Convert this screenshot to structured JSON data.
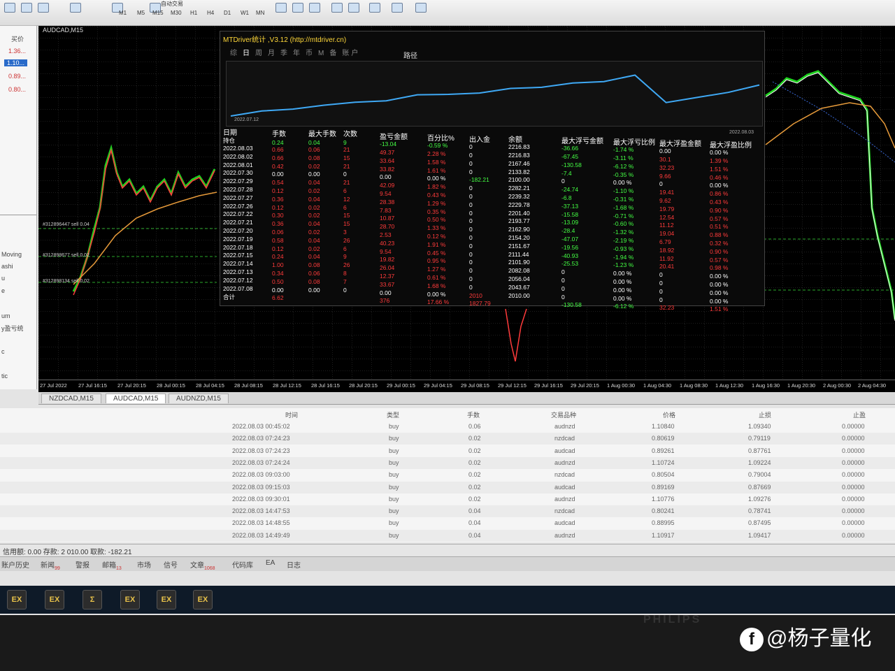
{
  "toolbar": {
    "autotrade_label": "自动交易",
    "timeframes": [
      "M1",
      "M5",
      "M15",
      "M30",
      "H1",
      "H4",
      "D1",
      "W1",
      "MN"
    ]
  },
  "left_panel": {
    "header": "买价",
    "prices": [
      "1.36...",
      "1.10...",
      "0.89...",
      "0.80..."
    ],
    "nav_items": [
      "Moving",
      "ashi",
      "u",
      "e",
      "um",
      "y盈亏统",
      "c",
      "tic"
    ]
  },
  "chart": {
    "title": "AUDCAD,M15",
    "order_labels": [
      "#312896447 sell 0.04",
      "#312898677 sell 0.02",
      "#312898134 sell 0.02"
    ],
    "time_ticks": [
      "27 Jul 2022",
      "27 Jul 16:15",
      "27 Jul 20:15",
      "28 Jul 00:15",
      "28 Jul 04:15",
      "28 Jul 08:15",
      "28 Jul 12:15",
      "28 Jul 16:15",
      "28 Jul 20:15",
      "29 Jul 00:15",
      "29 Jul 04:15",
      "29 Jul 08:15",
      "29 Jul 12:15",
      "29 Jul 16:15",
      "29 Jul 20:15",
      "1 Aug 00:30",
      "1 Aug 04:30",
      "1 Aug 08:30",
      "1 Aug 12:30",
      "1 Aug 16:30",
      "1 Aug 20:30",
      "2 Aug 00:30",
      "2 Aug 04:30"
    ]
  },
  "chart_tabs": [
    "NZDCAD,M15",
    "AUDCAD,M15",
    "AUDNZD,M15"
  ],
  "overlay": {
    "title": "MTDriver统计 ,V3.12 (http://mtdriver.cn)",
    "tabs": [
      "综",
      "日",
      "周",
      "月",
      "季",
      "年",
      "币",
      "M",
      "备",
      "账户"
    ],
    "selected_tab": "日",
    "path_label": "路径",
    "curve_start_date": "2022.07.12",
    "curve_end_date": "2022.08.03",
    "curve_color": "#3fa9f5",
    "headers": [
      "日期",
      "手数",
      "最大手数",
      "次数",
      "盈亏金额",
      "百分比%",
      "出入金",
      "余额",
      "最大浮亏金额",
      "最大浮亏比例",
      "最大浮盈金额",
      "最大浮盈比例"
    ],
    "hold_row": {
      "label": "持仓",
      "lots": "0.24",
      "max_lots": "0.04",
      "count": "9",
      "pnl": "-13.04",
      "pct": "-0.59 %",
      "deposit": "0",
      "balance": "2216.83",
      "max_float_loss": "-36.66",
      "max_float_loss_pct": "-1.74 %",
      "max_float_profit": "0.00",
      "max_float_profit_pct": "0.00 %"
    },
    "rows": [
      {
        "date": "2022.08.03",
        "lots": "0.66",
        "max_lots": "0.06",
        "count": "21",
        "pnl": "49.37",
        "pct": "2.28 %",
        "deposit": "0",
        "balance": "2216.83",
        "mfl": "-67.45",
        "mflp": "-3.11 %",
        "mfp": "30.1",
        "mfpp": "1.39 %"
      },
      {
        "date": "2022.08.02",
        "lots": "0.66",
        "max_lots": "0.08",
        "count": "15",
        "pnl": "33.64",
        "pct": "1.58 %",
        "deposit": "0",
        "balance": "2167.46",
        "mfl": "-130.58",
        "mflp": "-6.12 %",
        "mfp": "32.23",
        "mfpp": "1.51 %"
      },
      {
        "date": "2022.08.01",
        "lots": "0.42",
        "max_lots": "0.02",
        "count": "21",
        "pnl": "33.82",
        "pct": "1.61 %",
        "deposit": "0",
        "balance": "2133.82",
        "mfl": "-7.4",
        "mflp": "-0.35 %",
        "mfp": "9.66",
        "mfpp": "0.46 %"
      },
      {
        "date": "2022.07.30",
        "lots": "0.00",
        "max_lots": "0.00",
        "count": "0",
        "pnl": "0.00",
        "pct": "0.00 %",
        "deposit": "-182.21",
        "balance": "2100.00",
        "mfl": "0",
        "mflp": "0.00 %",
        "mfp": "0",
        "mfpp": "0.00 %"
      },
      {
        "date": "2022.07.29",
        "lots": "0.54",
        "max_lots": "0.04",
        "count": "21",
        "pnl": "42.09",
        "pct": "1.82 %",
        "deposit": "0",
        "balance": "2282.21",
        "mfl": "-24.74",
        "mflp": "-1.10 %",
        "mfp": "19.41",
        "mfpp": "0.86 %"
      },
      {
        "date": "2022.07.28",
        "lots": "0.12",
        "max_lots": "0.02",
        "count": "6",
        "pnl": "9.54",
        "pct": "0.43 %",
        "deposit": "0",
        "balance": "2239.32",
        "mfl": "-6.8",
        "mflp": "-0.31 %",
        "mfp": "9.62",
        "mfpp": "0.43 %"
      },
      {
        "date": "2022.07.27",
        "lots": "0.36",
        "max_lots": "0.04",
        "count": "12",
        "pnl": "28.38",
        "pct": "1.29 %",
        "deposit": "0",
        "balance": "2229.78",
        "mfl": "-37.13",
        "mflp": "-1.68 %",
        "mfp": "19.79",
        "mfpp": "0.90 %"
      },
      {
        "date": "2022.07.26",
        "lots": "0.12",
        "max_lots": "0.02",
        "count": "6",
        "pnl": "7.83",
        "pct": "0.35 %",
        "deposit": "0",
        "balance": "2201.40",
        "mfl": "-15.58",
        "mflp": "-0.71 %",
        "mfp": "12.54",
        "mfpp": "0.57 %"
      },
      {
        "date": "2022.07.22",
        "lots": "0.30",
        "max_lots": "0.02",
        "count": "15",
        "pnl": "10.87",
        "pct": "0.50 %",
        "deposit": "0",
        "balance": "2193.77",
        "mfl": "-13.09",
        "mflp": "-0.60 %",
        "mfp": "11.12",
        "mfpp": "0.51 %"
      },
      {
        "date": "2022.07.21",
        "lots": "0.36",
        "max_lots": "0.04",
        "count": "15",
        "pnl": "28.70",
        "pct": "1.33 %",
        "deposit": "0",
        "balance": "2162.90",
        "mfl": "-28.4",
        "mflp": "-1.32 %",
        "mfp": "19.04",
        "mfpp": "0.88 %"
      },
      {
        "date": "2022.07.20",
        "lots": "0.06",
        "max_lots": "0.02",
        "count": "3",
        "pnl": "2.53",
        "pct": "0.12 %",
        "deposit": "0",
        "balance": "2154.20",
        "mfl": "-47.07",
        "mflp": "-2.19 %",
        "mfp": "6.79",
        "mfpp": "0.32 %"
      },
      {
        "date": "2022.07.19",
        "lots": "0.58",
        "max_lots": "0.04",
        "count": "26",
        "pnl": "40.23",
        "pct": "1.91 %",
        "deposit": "0",
        "balance": "2151.67",
        "mfl": "-19.56",
        "mflp": "-0.93 %",
        "mfp": "18.92",
        "mfpp": "0.90 %"
      },
      {
        "date": "2022.07.18",
        "lots": "0.12",
        "max_lots": "0.02",
        "count": "6",
        "pnl": "9.54",
        "pct": "0.45 %",
        "deposit": "0",
        "balance": "2111.44",
        "mfl": "-40.93",
        "mflp": "-1.94 %",
        "mfp": "11.92",
        "mfpp": "0.57 %"
      },
      {
        "date": "2022.07.15",
        "lots": "0.24",
        "max_lots": "0.04",
        "count": "9",
        "pnl": "19.82",
        "pct": "0.95 %",
        "deposit": "0",
        "balance": "2101.90",
        "mfl": "-25.53",
        "mflp": "-1.23 %",
        "mfp": "20.41",
        "mfpp": "0.98 %"
      },
      {
        "date": "2022.07.14",
        "lots": "1.00",
        "max_lots": "0.08",
        "count": "26",
        "pnl": "26.04",
        "pct": "1.27 %",
        "deposit": "0",
        "balance": "2082.08",
        "mfl": "0",
        "mflp": "0.00 %",
        "mfp": "0",
        "mfpp": "0.00 %"
      },
      {
        "date": "2022.07.13",
        "lots": "0.34",
        "max_lots": "0.06",
        "count": "8",
        "pnl": "12.37",
        "pct": "0.61 %",
        "deposit": "0",
        "balance": "2056.04",
        "mfl": "0",
        "mflp": "0.00 %",
        "mfp": "0",
        "mfpp": "0.00 %"
      },
      {
        "date": "2022.07.12",
        "lots": "0.50",
        "max_lots": "0.08",
        "count": "7",
        "pnl": "33.67",
        "pct": "1.68 %",
        "deposit": "0",
        "balance": "2043.67",
        "mfl": "0",
        "mflp": "0.00 %",
        "mfp": "0",
        "mfpp": "0.00 %"
      },
      {
        "date": "2022.07.08",
        "lots": "0.00",
        "max_lots": "0.00",
        "count": "0",
        "pnl": "0.00",
        "pct": "0.00 %",
        "deposit": "2010",
        "balance": "2010.00",
        "mfl": "0",
        "mflp": "0.00 %",
        "mfp": "0",
        "mfpp": "0.00 %"
      }
    ],
    "total_row": {
      "label": "合计",
      "lots": "6.62",
      "pnl": "376",
      "pct": "17.66 %",
      "deposit": "1827.79",
      "mfl": "-130.58",
      "mflp": "-6.12 %",
      "mfp": "32.23",
      "mfpp": "1.51 %"
    }
  },
  "trade_table": {
    "headers": [
      "时间",
      "类型",
      "手数",
      "交易品种",
      "价格",
      "止损",
      "止盈"
    ],
    "rows": [
      [
        "2022.08.03 00:45:02",
        "buy",
        "0.06",
        "audnzd",
        "1.10840",
        "1.09340",
        "0.00000"
      ],
      [
        "2022.08.03 07:24:23",
        "buy",
        "0.02",
        "nzdcad",
        "0.80619",
        "0.79119",
        "0.00000"
      ],
      [
        "2022.08.03 07:24:23",
        "buy",
        "0.02",
        "audcad",
        "0.89261",
        "0.87761",
        "0.00000"
      ],
      [
        "2022.08.03 07:24:24",
        "buy",
        "0.02",
        "audnzd",
        "1.10724",
        "1.09224",
        "0.00000"
      ],
      [
        "2022.08.03 09:03:00",
        "buy",
        "0.02",
        "nzdcad",
        "0.80504",
        "0.79004",
        "0.00000"
      ],
      [
        "2022.08.03 09:15:03",
        "buy",
        "0.02",
        "audcad",
        "0.89169",
        "0.87669",
        "0.00000"
      ],
      [
        "2022.08.03 09:30:01",
        "buy",
        "0.02",
        "audnzd",
        "1.10776",
        "1.09276",
        "0.00000"
      ],
      [
        "2022.08.03 14:47:53",
        "buy",
        "0.04",
        "nzdcad",
        "0.80241",
        "0.78741",
        "0.00000"
      ],
      [
        "2022.08.03 14:48:55",
        "buy",
        "0.04",
        "audcad",
        "0.88995",
        "0.87495",
        "0.00000"
      ],
      [
        "2022.08.03 14:49:49",
        "buy",
        "0.04",
        "audnzd",
        "1.10917",
        "1.09417",
        "0.00000"
      ]
    ]
  },
  "status": {
    "text": "信用额: 0.00  存款: 2 010.00  取款: -182.21"
  },
  "bottom_tabs": [
    {
      "label": "账户历史",
      "badge": ""
    },
    {
      "label": "新闻",
      "badge": "99"
    },
    {
      "label": "警报",
      "badge": ""
    },
    {
      "label": "邮箱",
      "badge": "13"
    },
    {
      "label": "市场",
      "badge": ""
    },
    {
      "label": "信号",
      "badge": ""
    },
    {
      "label": "文章",
      "badge": "1068"
    },
    {
      "label": "代码库",
      "badge": ""
    },
    {
      "label": "EA",
      "badge": ""
    },
    {
      "label": "日志",
      "badge": ""
    }
  ],
  "taskbar": {
    "icons": [
      "EX",
      "EX",
      "Σ",
      "EX",
      "EX",
      "EX"
    ]
  },
  "bezel": {
    "brand": "PHILIPS"
  },
  "watermark": {
    "text": "@杨子量化"
  },
  "colors": {
    "positive": "#ff3b3b",
    "negative": "#44ff44",
    "header": "#ffffff",
    "title": "#ffd83a",
    "curve": "#3fa9f5"
  }
}
